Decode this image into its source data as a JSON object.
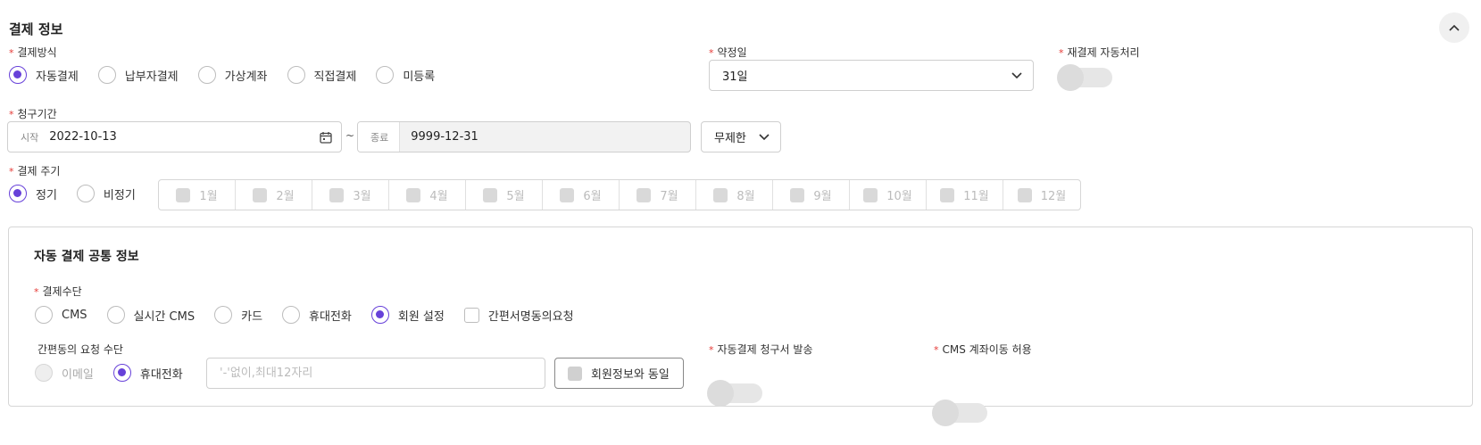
{
  "section": {
    "title": "결제 정보"
  },
  "payment_method": {
    "label": "결제방식",
    "options": [
      "자동결제",
      "납부자결제",
      "가상계좌",
      "직접결제",
      "미등록"
    ],
    "selected": 0
  },
  "promise_day": {
    "label": "약정일",
    "value": "31일"
  },
  "auto_retry": {
    "label": "재결제 자동처리",
    "on": false
  },
  "billing_period": {
    "label": "청구기간",
    "start_prefix": "시작",
    "start_value": "2022-10-13",
    "separator": "~",
    "end_prefix": "종료",
    "end_value": "9999-12-31",
    "limit_value": "무제한"
  },
  "payment_cycle": {
    "label": "결제 주기",
    "options": [
      "정기",
      "비정기"
    ],
    "selected": 0,
    "months": [
      "1월",
      "2월",
      "3월",
      "4월",
      "5월",
      "6월",
      "7월",
      "8월",
      "9월",
      "10월",
      "11월",
      "12월"
    ]
  },
  "auto_common": {
    "title": "자동 결제 공통 정보",
    "means": {
      "label": "결제수단",
      "options": [
        "CMS",
        "실시간 CMS",
        "카드",
        "휴대전화",
        "회원 설정"
      ],
      "selected": 4,
      "consent_checkbox": "간편서명동의요청"
    },
    "simple_consent": {
      "label": "간편동의 요청 수단",
      "options": [
        "이메일",
        "휴대전화"
      ],
      "selected": 1,
      "phone_placeholder": "'-'없이,최대12자리",
      "same_as_member": "회원정보와 동일"
    },
    "invoice": {
      "label": "자동결제 청구서 발송",
      "on": false
    },
    "cms_transfer": {
      "label": "CMS 계좌이동 허용",
      "on": false
    }
  },
  "colors": {
    "accent": "#6741d9",
    "required": "#e53935"
  }
}
